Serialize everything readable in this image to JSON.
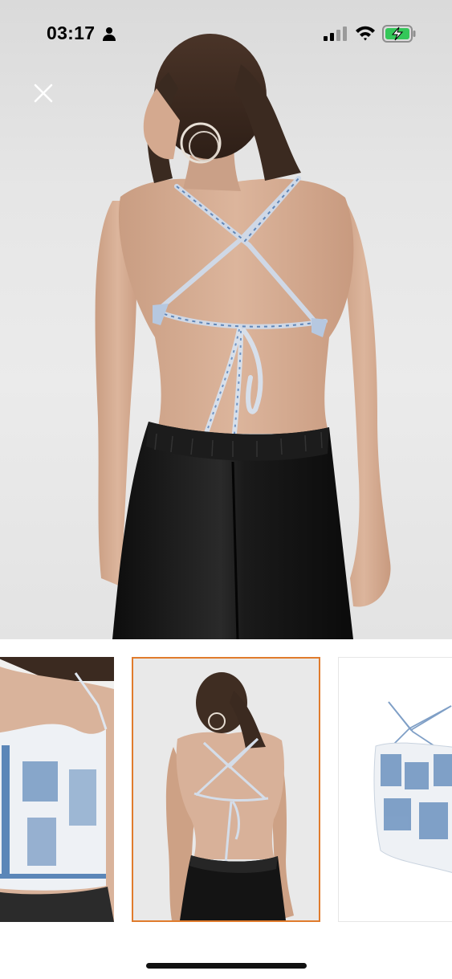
{
  "status_bar": {
    "time": "03:17",
    "person_icon": "person-icon",
    "signal_icon": "cellular-signal-icon",
    "wifi_icon": "wifi-icon",
    "battery_icon": "battery-charging-icon",
    "battery_color": "#34c759"
  },
  "viewer": {
    "close_icon": "close-icon",
    "selected_thumbnail_index": 1,
    "accent_color": "#e07b2c"
  },
  "thumbnails": [
    {
      "icon": "product-front-view-thumbnail"
    },
    {
      "icon": "product-back-view-thumbnail"
    },
    {
      "icon": "product-flat-view-thumbnail"
    }
  ]
}
